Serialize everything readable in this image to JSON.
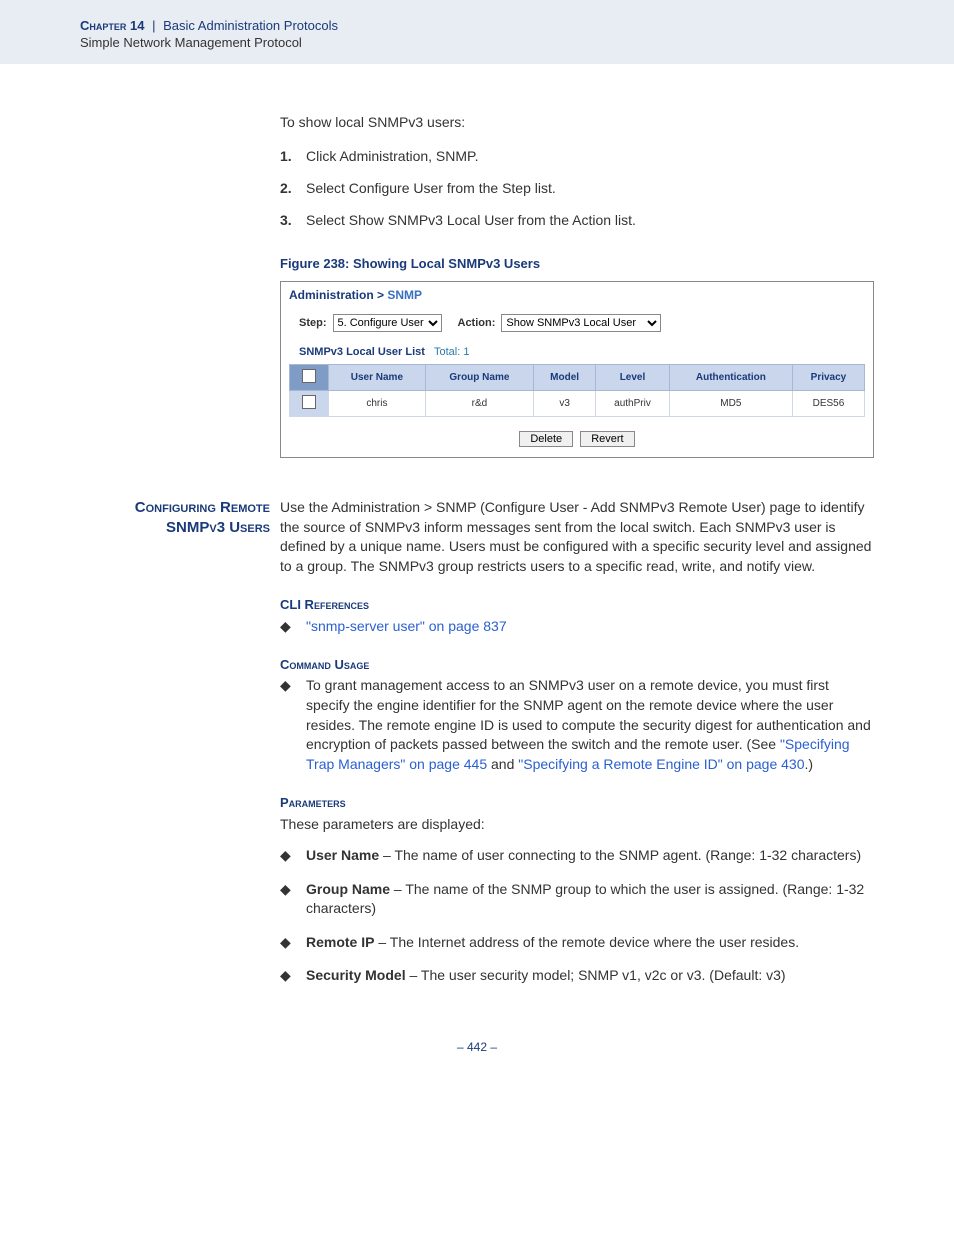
{
  "header": {
    "chapter": "Chapter 14",
    "separator": "|",
    "topic": "Basic Administration Protocols",
    "subtopic": "Simple Network Management Protocol"
  },
  "intro": "To show local SNMPv3 users:",
  "steps": [
    {
      "num": "1.",
      "text": "Click Administration, SNMP."
    },
    {
      "num": "2.",
      "text": "Select Configure User from the Step list."
    },
    {
      "num": "3.",
      "text": "Select Show SNMPv3 Local User from the Action list."
    }
  ],
  "figure": {
    "caption": "Figure 238:  Showing Local SNMPv3 Users",
    "nav_root": "Administration",
    "nav_sep": ">",
    "nav_leaf": "SNMP",
    "step_label": "Step:",
    "step_value": "5. Configure User",
    "action_label": "Action:",
    "action_value": "Show SNMPv3 Local User",
    "list_title": "SNMPv3 Local User List",
    "list_total": "Total: 1",
    "columns": [
      "User Name",
      "Group Name",
      "Model",
      "Level",
      "Authentication",
      "Privacy"
    ],
    "rows": [
      {
        "user": "chris",
        "group": "r&d",
        "model": "v3",
        "level": "authPriv",
        "auth": "MD5",
        "priv": "DES56"
      }
    ],
    "btn_delete": "Delete",
    "btn_revert": "Revert"
  },
  "section": {
    "heading_line1": "Configuring Remote",
    "heading_line2": "SNMPv3 Users",
    "body": "Use the Administration > SNMP (Configure User - Add SNMPv3 Remote User) page to identify the source of SNMPv3 inform messages sent from the local switch. Each SNMPv3 user is defined by a unique name. Users must be configured with a specific security level and assigned to a group. The SNMPv3 group restricts users to a specific read, write, and notify view.",
    "cli_heading": "CLI References",
    "cli_link": "\"snmp-server user\" on page 837",
    "usage_heading": "Command Usage",
    "usage_pre": "To grant management access to an SNMPv3 user on a remote device, you must first specify the engine identifier for the SNMP agent on the remote device where the user resides. The remote engine ID is used to compute the security digest for authentication and encryption of packets passed between the switch and the remote user. (See ",
    "usage_link1": "\"Specifying Trap Managers\" on page 445",
    "usage_mid": " and ",
    "usage_link2": "\"Specifying a Remote Engine ID\" on page 430",
    "usage_post": ".)",
    "params_heading": "Parameters",
    "params_intro": "These parameters are displayed:",
    "params": [
      {
        "name": "User Name",
        "desc": " – The name of user connecting to the SNMP agent. (Range: 1-32 characters)"
      },
      {
        "name": "Group Name",
        "desc": " – The name of the SNMP group to which the user is assigned. (Range: 1-32 characters)"
      },
      {
        "name": "Remote IP",
        "desc": " – The Internet address of the remote device where the user resides."
      },
      {
        "name": "Security Model",
        "desc": " – The user security model; SNMP v1, v2c or v3. (Default: v3)"
      }
    ]
  },
  "page_number": "–  442  –"
}
